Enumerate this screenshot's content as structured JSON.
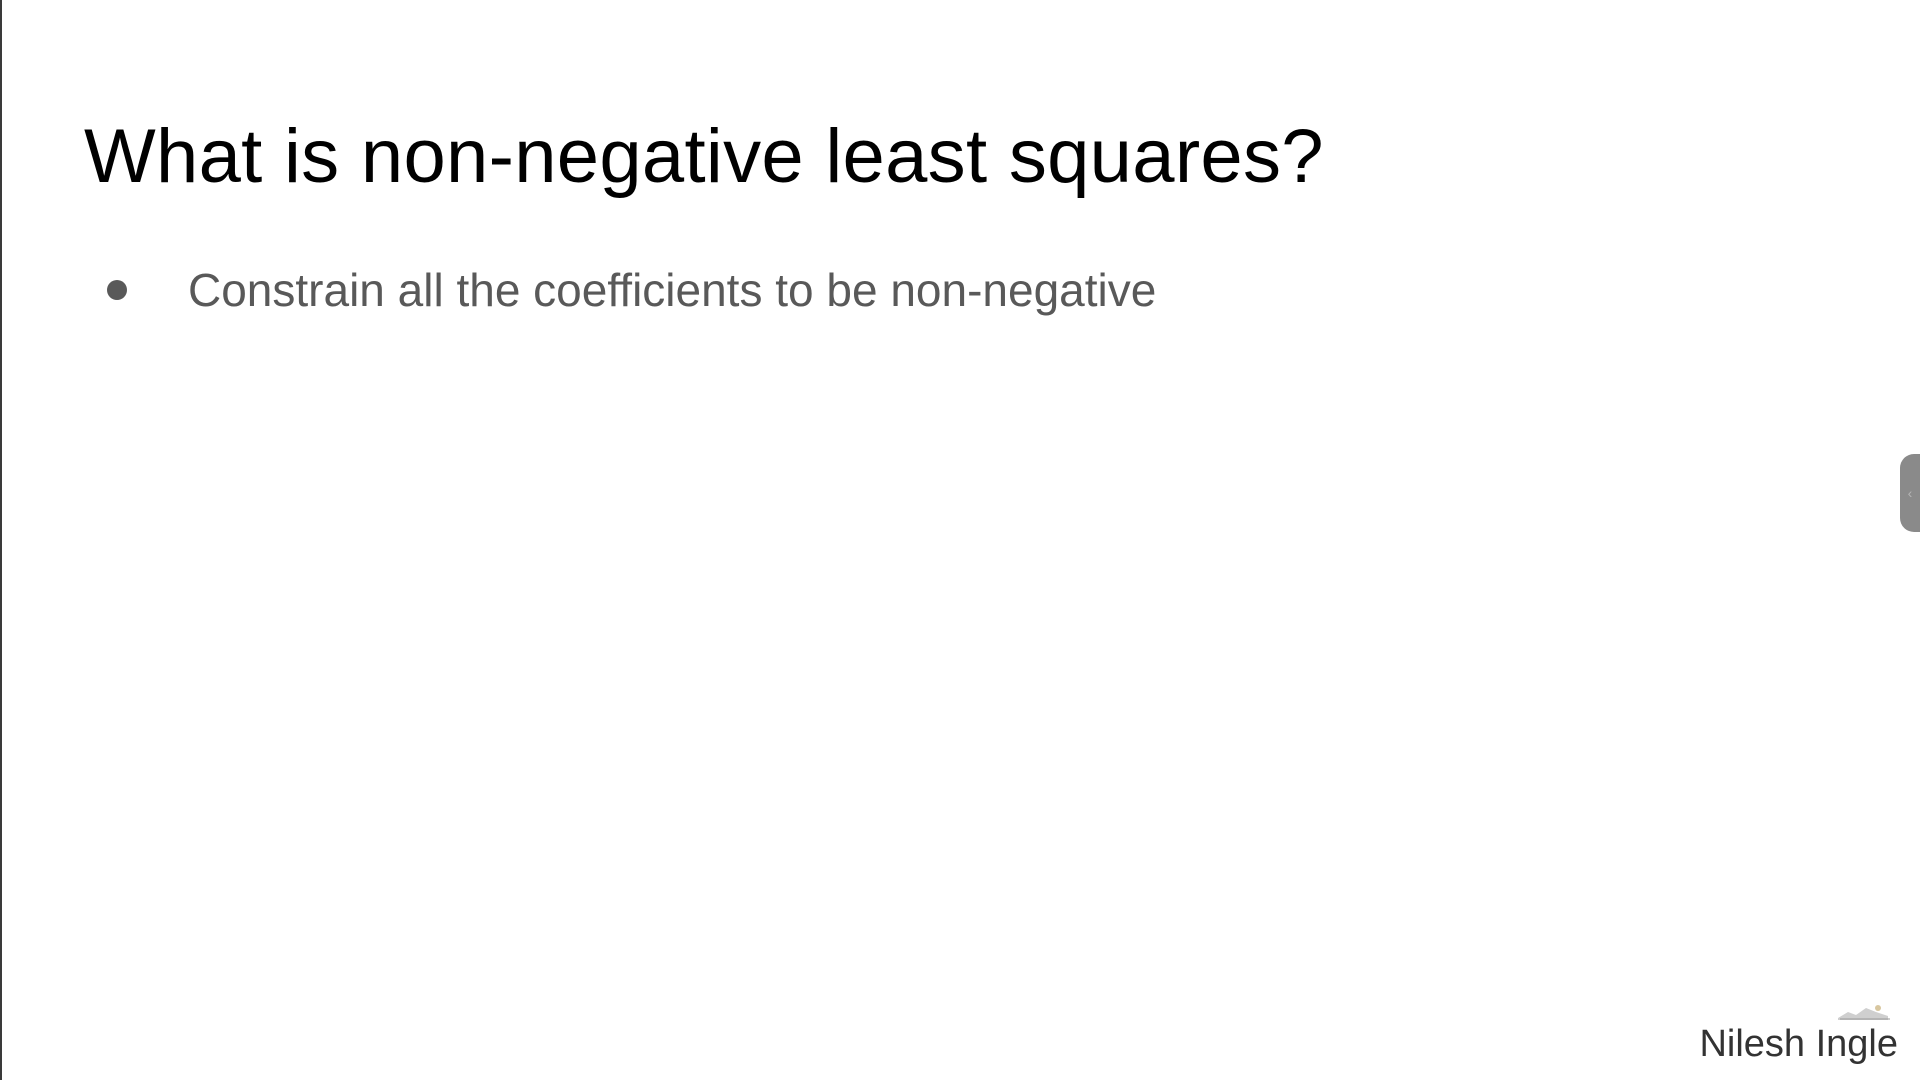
{
  "slide": {
    "title": "What is non-negative least squares?",
    "bullets": [
      {
        "text": "Constrain all the coefficients to be non-negative"
      }
    ],
    "footer": {
      "author": "Nilesh Ingle",
      "logo_icon": "landscape-logo-icon"
    },
    "side_panel_icon": "chevron-left-icon"
  },
  "colors": {
    "background": "#ffffff",
    "title": "#000000",
    "bullet_text": "#595959",
    "footer_text": "#333333"
  }
}
